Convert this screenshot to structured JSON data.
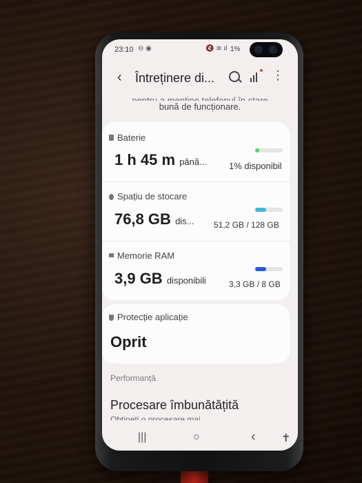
{
  "status_bar": {
    "time": "23:10",
    "battery": "1%"
  },
  "app_bar": {
    "title": "Întreținere di...",
    "back_icon": "chevron-left-icon",
    "search_icon": "search-icon",
    "stats_icon": "bar-chart-icon",
    "more_icon": "more-vertical-icon"
  },
  "intro": {
    "line1": "pentru a menține telefonul în stare",
    "line2": "bună de funcționare."
  },
  "battery": {
    "label": "Baterie",
    "value": "1 h 45 m",
    "suffix": "până...",
    "detail": "1% disponibil",
    "level": 0.01,
    "color": "#4cd964"
  },
  "storage": {
    "label": "Spațiu de stocare",
    "value": "76,8 GB",
    "suffix": "dis...",
    "detail": "51,2 GB / 128 GB",
    "used_fraction": 0.4,
    "color": "#3fb8d8"
  },
  "ram": {
    "label": "Memorie RAM",
    "value": "3,9 GB",
    "suffix": "disponibili",
    "detail": "3,3 GB / 8 GB",
    "used_fraction": 0.41,
    "color": "#2a5bd7"
  },
  "app_protection": {
    "label": "Protecție aplicație",
    "value": "Oprit"
  },
  "performance": {
    "section": "Performanță",
    "title": "Procesare îmbunătățită",
    "subtitle": "Obțineți o procesare mai"
  },
  "nav": {
    "recents": "|||",
    "home": "○",
    "back": "‹",
    "accessibility": "accessibility-icon"
  }
}
